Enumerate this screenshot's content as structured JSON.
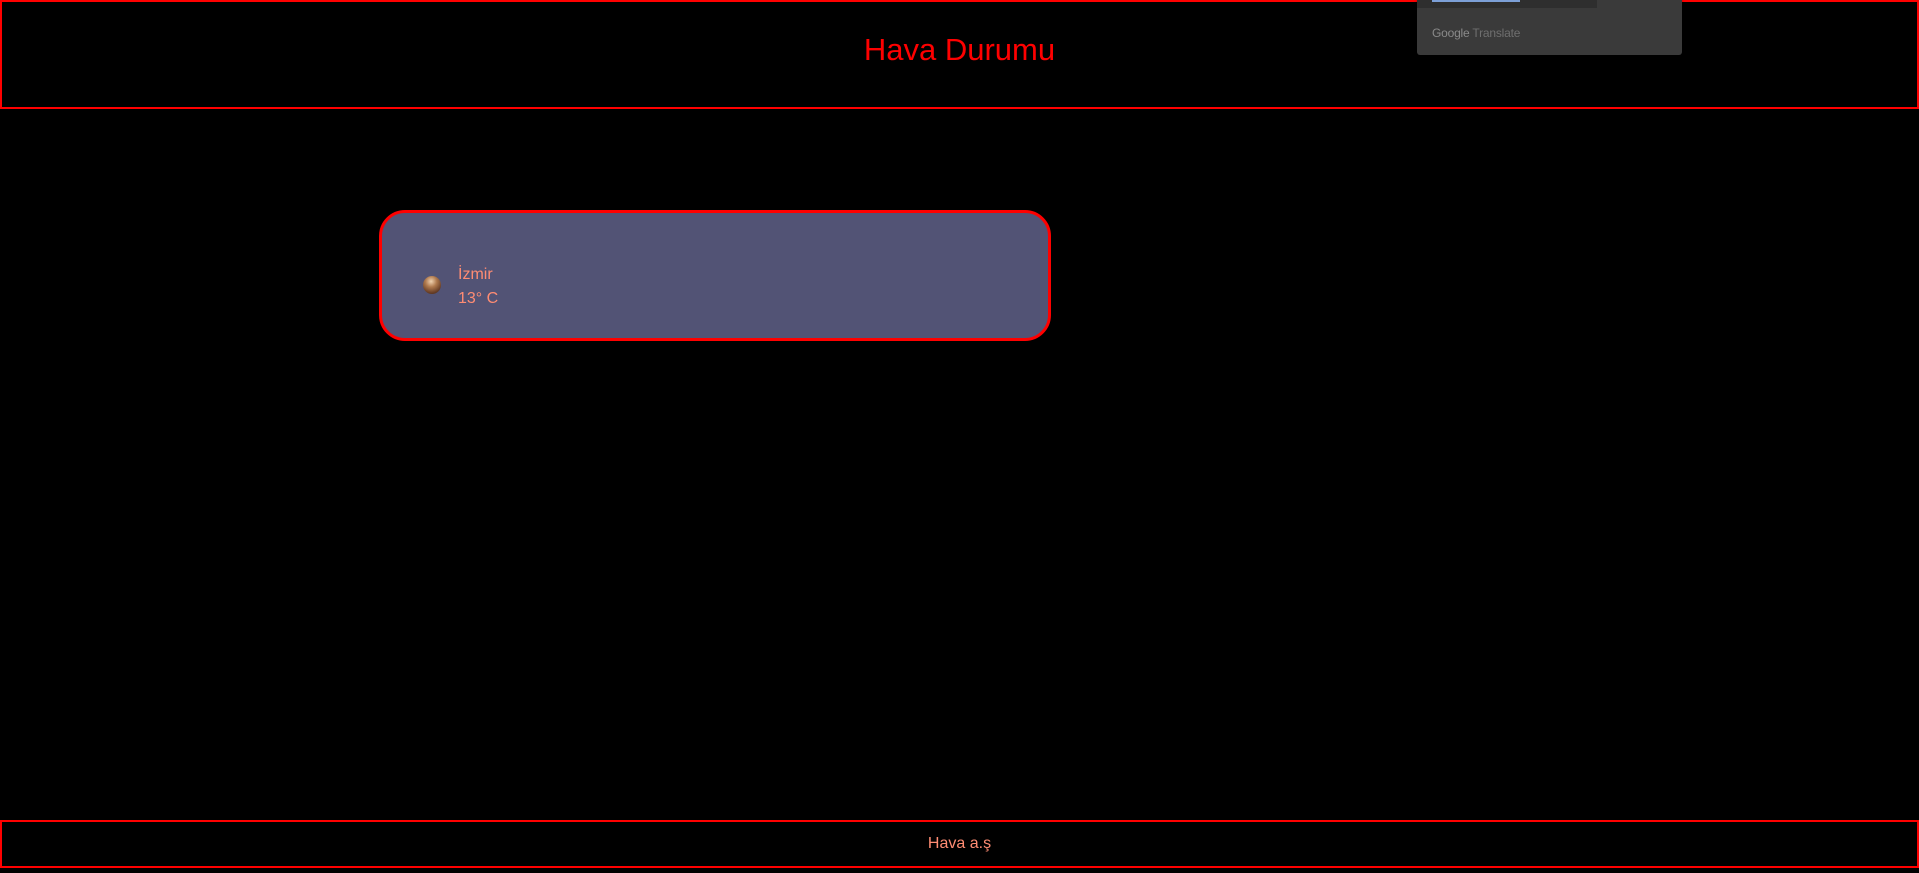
{
  "header": {
    "title": "Hava Durumu"
  },
  "translate_widget": {
    "brand_google": "Google",
    "brand_translate": "Translate"
  },
  "weather_card": {
    "icon": "moon-icon",
    "city": "İzmir",
    "temperature": "13° C"
  },
  "footer": {
    "text": "Hava a.ş"
  },
  "colors": {
    "background": "#000000",
    "accent_border": "#ff0000",
    "title": "#ff0000",
    "card_background": "#525375",
    "text": "#ff8c73"
  }
}
